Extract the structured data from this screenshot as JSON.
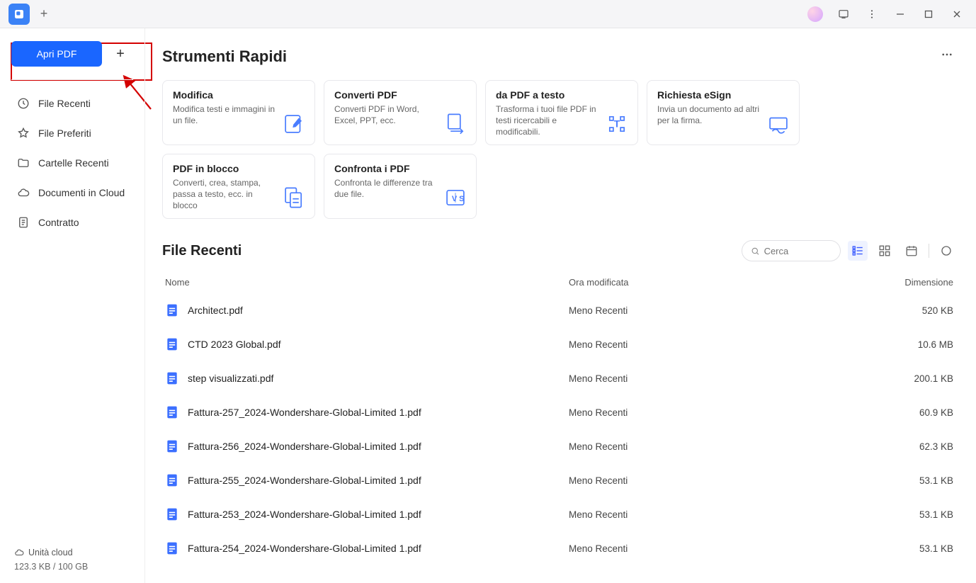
{
  "sidebar": {
    "open_label": "Apri PDF",
    "items": [
      {
        "label": "File Recenti"
      },
      {
        "label": "File Preferiti"
      },
      {
        "label": "Cartelle Recenti"
      },
      {
        "label": "Documenti in Cloud"
      },
      {
        "label": "Contratto"
      }
    ],
    "cloud_label": "Unità cloud",
    "storage": "123.3 KB / 100 GB"
  },
  "quick_tools": {
    "title": "Strumenti Rapidi",
    "cards": [
      {
        "title": "Modifica",
        "desc": "Modifica testi e immagini in un file."
      },
      {
        "title": "Converti PDF",
        "desc": "Converti PDF in Word, Excel, PPT, ecc."
      },
      {
        "title": "da PDF a testo",
        "desc": "Trasforma i tuoi file PDF in testi ricercabili e modificabili."
      },
      {
        "title": "Richiesta eSign",
        "desc": "Invia un documento ad altri per la firma."
      },
      {
        "title": "PDF in blocco",
        "desc": "Converti, crea, stampa, passa a testo, ecc. in blocco"
      },
      {
        "title": "Confronta i PDF",
        "desc": "Confronta le differenze tra due file."
      }
    ]
  },
  "recent": {
    "title": "File Recenti",
    "search_placeholder": "Cerca",
    "columns": {
      "name": "Nome",
      "date": "Ora modificata",
      "size": "Dimensione"
    },
    "files": [
      {
        "name": "Architect.pdf",
        "date": "Meno Recenti",
        "size": "520 KB"
      },
      {
        "name": "CTD 2023 Global.pdf",
        "date": "Meno Recenti",
        "size": "10.6 MB"
      },
      {
        "name": "step visualizzati.pdf",
        "date": "Meno Recenti",
        "size": "200.1 KB"
      },
      {
        "name": "Fattura-257_2024-Wondershare-Global-Limited 1.pdf",
        "date": "Meno Recenti",
        "size": "60.9 KB"
      },
      {
        "name": "Fattura-256_2024-Wondershare-Global-Limited 1.pdf",
        "date": "Meno Recenti",
        "size": "62.3 KB"
      },
      {
        "name": "Fattura-255_2024-Wondershare-Global-Limited 1.pdf",
        "date": "Meno Recenti",
        "size": "53.1 KB"
      },
      {
        "name": "Fattura-253_2024-Wondershare-Global-Limited 1.pdf",
        "date": "Meno Recenti",
        "size": "53.1 KB"
      },
      {
        "name": "Fattura-254_2024-Wondershare-Global-Limited 1.pdf",
        "date": "Meno Recenti",
        "size": "53.1 KB"
      }
    ]
  }
}
